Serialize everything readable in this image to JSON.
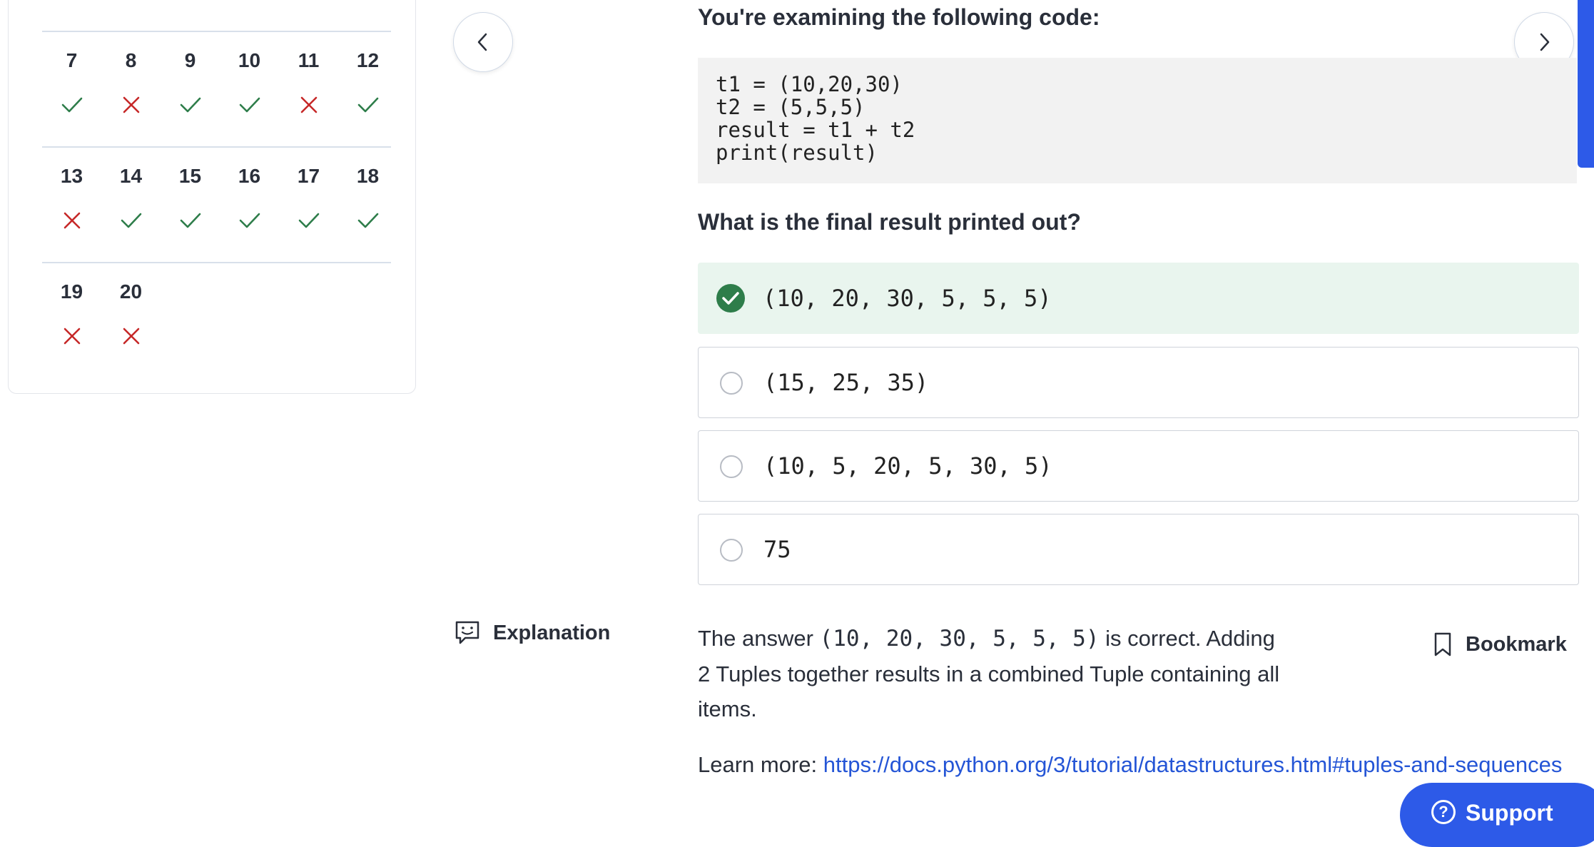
{
  "results": {
    "rows": [
      {
        "items": [
          {
            "num": "",
            "status": "correct"
          },
          {
            "num": "",
            "status": "correct"
          },
          {
            "num": "",
            "status": "incorrect"
          },
          {
            "num": "",
            "status": "correct"
          },
          {
            "num": "",
            "status": "correct"
          },
          {
            "num": "",
            "status": "correct"
          }
        ]
      },
      {
        "items": [
          {
            "num": "7",
            "status": "correct"
          },
          {
            "num": "8",
            "status": "incorrect"
          },
          {
            "num": "9",
            "status": "correct"
          },
          {
            "num": "10",
            "status": "correct"
          },
          {
            "num": "11",
            "status": "incorrect"
          },
          {
            "num": "12",
            "status": "correct"
          }
        ]
      },
      {
        "items": [
          {
            "num": "13",
            "status": "incorrect"
          },
          {
            "num": "14",
            "status": "correct"
          },
          {
            "num": "15",
            "status": "correct"
          },
          {
            "num": "16",
            "status": "correct"
          },
          {
            "num": "17",
            "status": "correct"
          },
          {
            "num": "18",
            "status": "correct"
          }
        ]
      },
      {
        "items": [
          {
            "num": "19",
            "status": "incorrect"
          },
          {
            "num": "20",
            "status": "incorrect"
          }
        ]
      }
    ]
  },
  "nav": {
    "prev_icon": "chevron-left-icon",
    "next_icon": "chevron-right-icon"
  },
  "question": {
    "prompt": "You're examining the following code:",
    "code": "t1 = (10,20,30)\nt2 = (5,5,5)\nresult = t1 + t2\nprint(result)",
    "text": "What is the final result printed out?",
    "options": [
      {
        "label": "(10, 20, 30, 5, 5, 5)",
        "correct": true
      },
      {
        "label": "(15, 25, 35)",
        "correct": false
      },
      {
        "label": "(10, 5, 20, 5, 30, 5)",
        "correct": false
      },
      {
        "label": "75",
        "correct": false
      }
    ]
  },
  "explanation": {
    "label": "Explanation",
    "text_before": "The answer ",
    "answer_code": "(10, 20, 30, 5, 5, 5)",
    "text_after": " is correct. Adding 2 Tuples together results in a combined Tuple containing all items.",
    "learn_more_label": "Learn more: ",
    "learn_more_url": "https://docs.python.org/3/tutorial/datastructures.html#tuples-and-sequences"
  },
  "bookmark": {
    "label": "Bookmark"
  },
  "support": {
    "label": "Support"
  },
  "colors": {
    "correct": "#2e7d4a",
    "incorrect": "#c62828",
    "accent": "#2d5ae8",
    "link": "#2455d6"
  }
}
